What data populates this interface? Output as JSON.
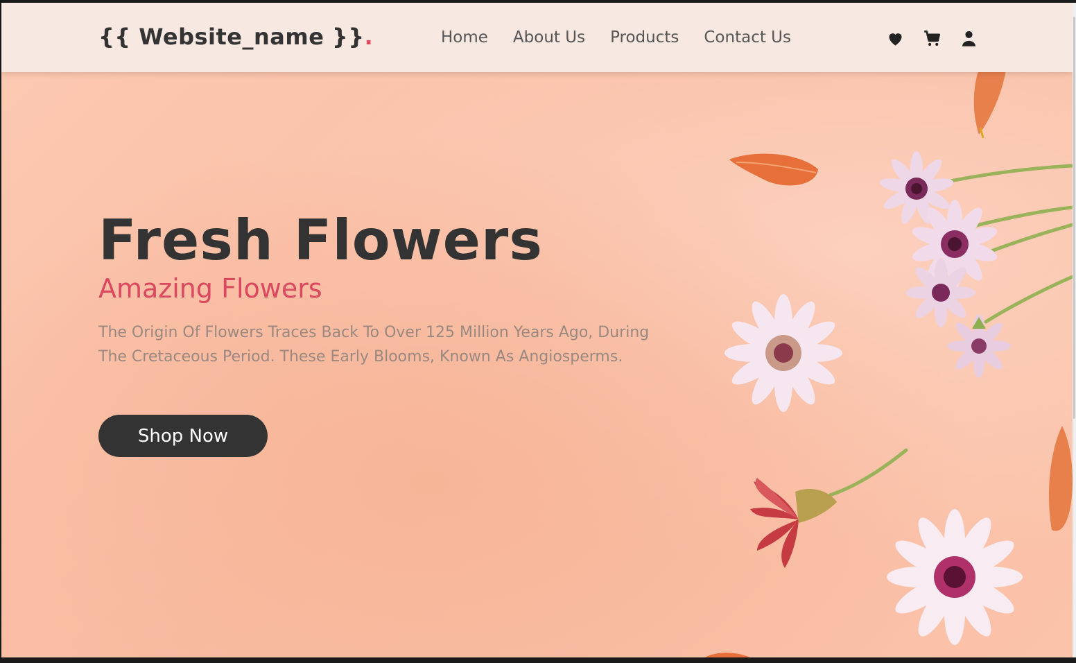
{
  "header": {
    "logo_text": "{{ Website_name }}",
    "logo_dot": "."
  },
  "nav": {
    "items": [
      {
        "label": "Home"
      },
      {
        "label": "About Us"
      },
      {
        "label": "Products"
      },
      {
        "label": "Contact Us"
      }
    ]
  },
  "header_icons": [
    "heart-icon",
    "cart-icon",
    "user-icon"
  ],
  "hero": {
    "title": "Fresh Flowers",
    "subtitle": "Amazing Flowers",
    "description": "The Origin Of Flowers Traces Back To Over 125 Million Years Ago, During The Cretaceous Period. These Early Blooms, Known As Angiosperms.",
    "button_label": "Shop Now"
  },
  "colors": {
    "accent": "#d9485f",
    "dark": "#333333",
    "header_bg": "#f7e8e1",
    "hero_bg": "#fbc3aa"
  }
}
